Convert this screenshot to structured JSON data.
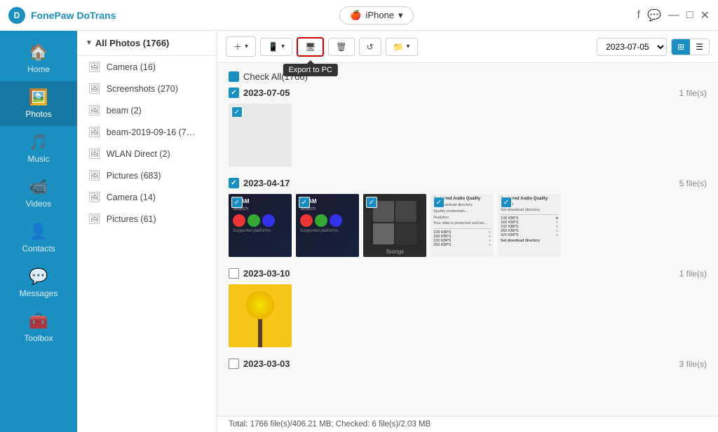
{
  "app": {
    "name": "FonePaw DoTrans",
    "logo_letter": "D"
  },
  "device": {
    "name": "iPhone",
    "dropdown_arrow": "▾"
  },
  "window_controls": {
    "fb": "f",
    "msg": "…",
    "minimize": "—",
    "restore": "□",
    "close": "✕"
  },
  "sidebar": {
    "items": [
      {
        "id": "home",
        "label": "Home",
        "icon": "⌂"
      },
      {
        "id": "photos",
        "label": "Photos",
        "icon": "🖼",
        "active": true
      },
      {
        "id": "music",
        "label": "Music",
        "icon": "♪"
      },
      {
        "id": "videos",
        "label": "Videos",
        "icon": "▶"
      },
      {
        "id": "contacts",
        "label": "Contacts",
        "icon": "👤"
      },
      {
        "id": "messages",
        "label": "Messages",
        "icon": "💬"
      },
      {
        "id": "toolbox",
        "label": "Toolbox",
        "icon": "🔧"
      }
    ]
  },
  "left_panel": {
    "header": "All Photos (1766)",
    "albums": [
      {
        "name": "Camera (16)"
      },
      {
        "name": "Screenshots (270)"
      },
      {
        "name": "beam (2)"
      },
      {
        "name": "beam-2019-09-16 (7…"
      },
      {
        "name": "WLAN Direct (2)"
      },
      {
        "name": "Pictures (683)"
      },
      {
        "name": "Camera (14)"
      },
      {
        "name": "Pictures (61)"
      }
    ]
  },
  "toolbar": {
    "add_label": "+",
    "export_to_device_label": "⇄",
    "export_to_pc_label": "⬛",
    "export_to_pc_tooltip": "Export to PC",
    "delete_label": "🗑",
    "refresh_label": "↺",
    "folder_label": "📁",
    "date_value": "2023-07-05",
    "view_grid_icon": "▦",
    "view_list_icon": "▤"
  },
  "photos": {
    "check_all_label": "Check All(1766)",
    "sections": [
      {
        "date": "2023-07-05",
        "checked": true,
        "file_count": "1 file(s)",
        "thumbs": [
          {
            "type": "blank",
            "checked": true
          }
        ]
      },
      {
        "date": "2023-04-17",
        "checked": true,
        "file_count": "5 file(s)",
        "thumbs": [
          {
            "type": "dark",
            "checked": true
          },
          {
            "type": "dark2",
            "checked": true
          },
          {
            "type": "music",
            "checked": true
          },
          {
            "type": "list-dark",
            "checked": true
          },
          {
            "type": "list-dark2",
            "checked": true
          }
        ]
      },
      {
        "date": "2023-03-10",
        "checked": false,
        "file_count": "1 file(s)",
        "thumbs": [
          {
            "type": "yellow",
            "checked": false
          }
        ]
      },
      {
        "date": "2023-03-03",
        "checked": false,
        "file_count": "3 file(s)",
        "thumbs": []
      }
    ]
  },
  "status_bar": {
    "text": "Total: 1766 file(s)/406.21 MB; Checked: 6 file(s)/2.03 MB"
  }
}
